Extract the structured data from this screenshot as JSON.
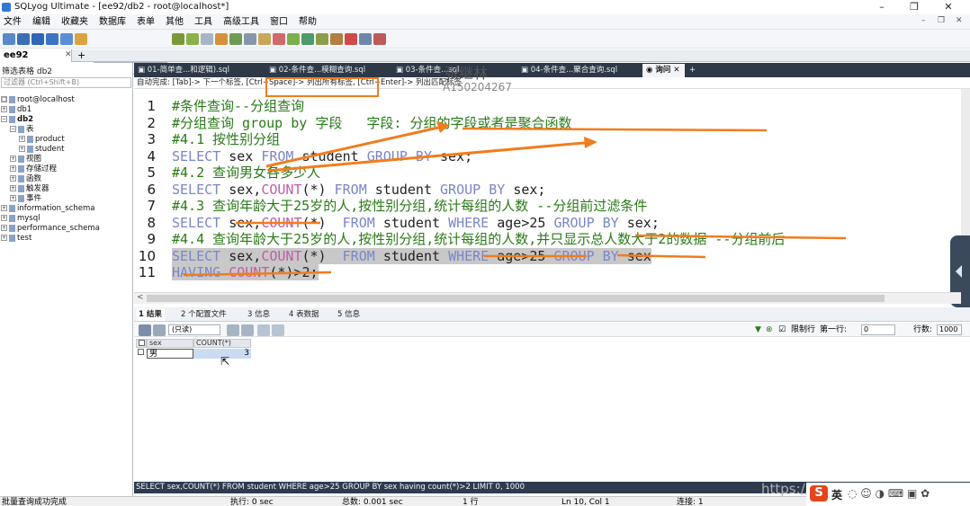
{
  "window": {
    "title": "SQLyog Ultimate - [ee92/db2 - root@localhost*]",
    "minimize": "–",
    "maximize": "❐",
    "close": "✕"
  },
  "menu": [
    "文件",
    "编辑",
    "收藏夹",
    "数据库",
    "表单",
    "其他",
    "工具",
    "高级工具",
    "窗口",
    "帮助"
  ],
  "menu_right": {
    "minimize": "–",
    "restore": "❐",
    "close": "✕"
  },
  "toolbar": {
    "db_select": "db2"
  },
  "connection_tab": {
    "label": "ee92",
    "close": "✕",
    "add": "+"
  },
  "sidebar": {
    "filter_label": "筛选表格 db2",
    "filter_placeholder": "过滤器 (Ctrl+Shift+B)",
    "tree": [
      {
        "label": "root@localhost",
        "depth": 0,
        "exp": "□"
      },
      {
        "label": "db1",
        "depth": 0,
        "exp": "+"
      },
      {
        "label": "db2",
        "depth": 0,
        "exp": "−"
      },
      {
        "label": "表",
        "depth": 1,
        "exp": "−"
      },
      {
        "label": "product",
        "depth": 2,
        "exp": "+"
      },
      {
        "label": "student",
        "depth": 2,
        "exp": "+"
      },
      {
        "label": "视图",
        "depth": 1,
        "exp": "+"
      },
      {
        "label": "存储过程",
        "depth": 1,
        "exp": "+"
      },
      {
        "label": "函数",
        "depth": 1,
        "exp": "+"
      },
      {
        "label": "触发器",
        "depth": 1,
        "exp": "+"
      },
      {
        "label": "事件",
        "depth": 1,
        "exp": "+"
      },
      {
        "label": "information_schema",
        "depth": 0,
        "exp": "+"
      },
      {
        "label": "mysql",
        "depth": 0,
        "exp": "+"
      },
      {
        "label": "performance_schema",
        "depth": 0,
        "exp": "+"
      },
      {
        "label": "test",
        "depth": 0,
        "exp": "+"
      }
    ]
  },
  "editor_tabs": [
    {
      "label": "01-简单查...和逻辑).sql"
    },
    {
      "label": "02-条件查...模糊查询.sql"
    },
    {
      "label": "03-条件查...sql"
    },
    {
      "label": "04-条件查...聚合查询.sql"
    },
    {
      "label": "询问"
    }
  ],
  "editor_tab_add": "+",
  "hint_bar": "自动完成: [Tab]-> 下一个标签, [Ctrl+Space]-> 列出所有标签, [Ctrl+Enter]-> 列出匹配标签",
  "editor_lines": [
    {
      "n": "1",
      "parts": [
        {
          "t": "#条件查询--分组查询",
          "c": "cmt"
        }
      ]
    },
    {
      "n": "2",
      "parts": [
        {
          "t": "#分组查询 group by 字段   字段: 分组的字段或者是聚合函数",
          "c": "cmt"
        }
      ]
    },
    {
      "n": "3",
      "parts": [
        {
          "t": "#4.1 按性别分组",
          "c": "cmt"
        }
      ]
    },
    {
      "n": "4",
      "parts": [
        {
          "t": "SELECT ",
          "c": "kw"
        },
        {
          "t": "sex ",
          "c": "tx"
        },
        {
          "t": "FROM ",
          "c": "kw"
        },
        {
          "t": "student ",
          "c": "tx"
        },
        {
          "t": "GROUP BY ",
          "c": "kw"
        },
        {
          "t": "sex;",
          "c": "tx"
        }
      ]
    },
    {
      "n": "5",
      "parts": [
        {
          "t": "#4.2 查询男女各多少人",
          "c": "cmt"
        }
      ]
    },
    {
      "n": "6",
      "parts": [
        {
          "t": "SELECT ",
          "c": "kw"
        },
        {
          "t": "sex,",
          "c": "tx"
        },
        {
          "t": "COUNT",
          "c": "fn"
        },
        {
          "t": "(*) ",
          "c": "tx"
        },
        {
          "t": "FROM ",
          "c": "kw"
        },
        {
          "t": "student ",
          "c": "tx"
        },
        {
          "t": "GROUP BY ",
          "c": "kw"
        },
        {
          "t": "sex;",
          "c": "tx"
        }
      ]
    },
    {
      "n": "7",
      "parts": [
        {
          "t": "#4.3 查询年龄大于25岁的人,按性别分组,统计每组的人数 --分组前过滤条件",
          "c": "cmt"
        }
      ]
    },
    {
      "n": "8",
      "parts": [
        {
          "t": "SELECT ",
          "c": "kw"
        },
        {
          "t": "sex,",
          "c": "tx"
        },
        {
          "t": "COUNT",
          "c": "fn"
        },
        {
          "t": "(*)  ",
          "c": "tx"
        },
        {
          "t": "FROM ",
          "c": "kw"
        },
        {
          "t": "student ",
          "c": "tx"
        },
        {
          "t": "WHERE ",
          "c": "kw"
        },
        {
          "t": "age>25 ",
          "c": "tx"
        },
        {
          "t": "GROUP BY ",
          "c": "kw"
        },
        {
          "t": "sex;",
          "c": "tx"
        }
      ]
    },
    {
      "n": "9",
      "parts": [
        {
          "t": "#4.4 查询年龄大于25岁的人,按性别分组,统计每组的人数,并只显示总人数大于2的数据 --分组前后",
          "c": "cmt"
        }
      ]
    },
    {
      "n": "10",
      "parts": [
        {
          "t": "SELECT ",
          "c": "kw"
        },
        {
          "t": "sex,",
          "c": "tx"
        },
        {
          "t": "COUNT",
          "c": "fn"
        },
        {
          "t": "(*)  ",
          "c": "tx"
        },
        {
          "t": "FROM ",
          "c": "kw"
        },
        {
          "t": "student ",
          "c": "tx"
        },
        {
          "t": "WHERE ",
          "c": "kw"
        },
        {
          "t": "age>25 ",
          "c": "tx"
        },
        {
          "t": "GROUP BY ",
          "c": "kw"
        },
        {
          "t": "sex",
          "c": "tx"
        }
      ],
      "selected": true
    },
    {
      "n": "11",
      "parts": [
        {
          "t": "HAVING ",
          "c": "kw"
        },
        {
          "t": "COUNT",
          "c": "fn"
        },
        {
          "t": "(*)>2;",
          "c": "tx"
        }
      ],
      "selected": true
    }
  ],
  "result_tabs": [
    "1 结果",
    "2 个配置文件",
    "3 信息",
    "4 表数据",
    "5 信息"
  ],
  "result_toolbar": {
    "readonly": "(只读)",
    "limit_label": "限制行",
    "first_row_label": "第一行:",
    "first_row": "0",
    "rows_label": "行数:",
    "rows": "1000"
  },
  "result_grid": {
    "columns": [
      "sex",
      "COUNT(*)"
    ],
    "rows": [
      [
        "男",
        "3"
      ]
    ]
  },
  "sql_status": "SELECT sex,COUNT(*) FROM student WHERE age>25 GROUP BY sex having count(*)>2 LIMIT 0, 1000",
  "statusbar": {
    "msg": "批量查询成功完成",
    "exec": "执行: 0 sec",
    "total": "总数: 0.001 sec",
    "rows": "1 行",
    "pos": "Ln 10, Col 1",
    "conn": "连接: 1"
  },
  "watermarks": {
    "name": "张继林",
    "id": "A150204267",
    "url": "https://b"
  },
  "ime": {
    "logo": "S",
    "lang": "英"
  }
}
